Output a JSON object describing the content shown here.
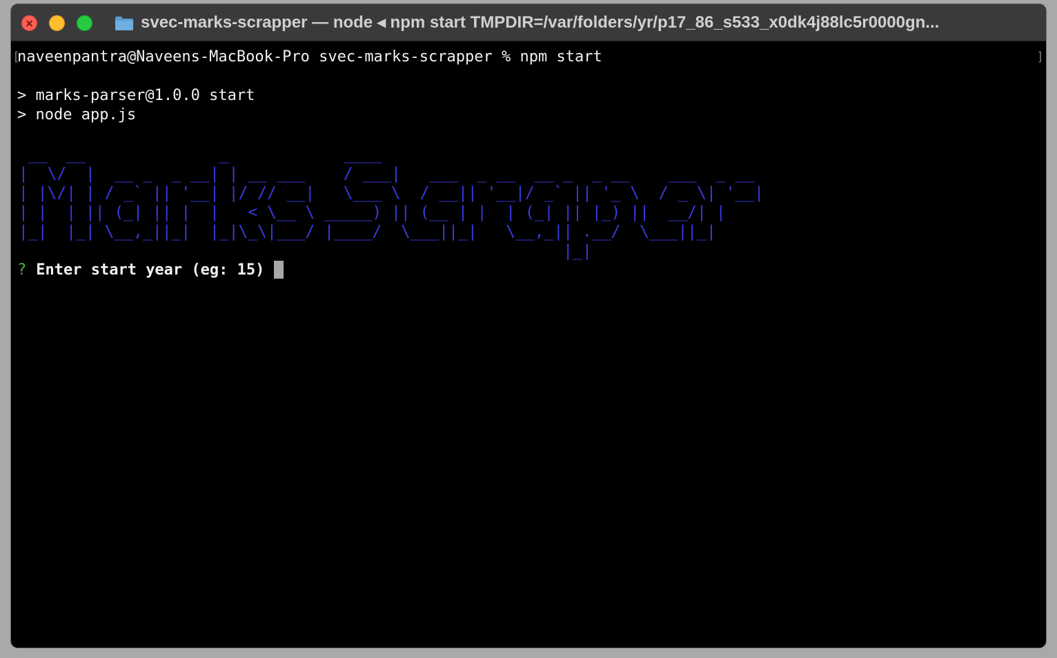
{
  "window": {
    "title": "svec-marks-scrapper — node ◂ npm start TMPDIR=/var/folders/yr/p17_86_s533_x0dk4j88lc5r0000gn..."
  },
  "icons": {
    "close": "close-icon",
    "minimize": "minimize-icon",
    "zoom": "zoom-icon",
    "folder": "folder-icon"
  },
  "colors": {
    "background": "#000000",
    "text": "#f2f2f2",
    "banner": "#3a3ae0",
    "prompt_marker": "#46b946",
    "cursor": "#a8a8a8"
  },
  "terminal": {
    "command_line": "naveenpantra@Naveens-MacBook-Pro svec-marks-scrapper % npm start",
    "script_line": "> marks-parser@1.0.0 start",
    "node_line": "> node app.js",
    "banner": " __  __              _            ____                                           \n|  \\/  |  __ _  _ __| | __ ___    / ___|   ___  _ __  __ _  _ __    ___  _ __ \n| |\\/| | / _` || '__| |/ // __|   \\___ \\  / __|| '__|/ _` || '_ \\  / _ \\| '__|\n| |  | || (_| || |  |   < \\__ \\ _____) || (__ | |  | (_| || |_) ||  __/| |   \n|_|  |_| \\__,_||_|  |_|\\_\\|___/ |____/  \\___||_|   \\__,_|| .__/  \\___||_|   \n                                                         |_|                ",
    "banner_text": "Marks - Scraper",
    "prompt_marker": "?",
    "prompt_text": "Enter start year (eg: 15)"
  }
}
